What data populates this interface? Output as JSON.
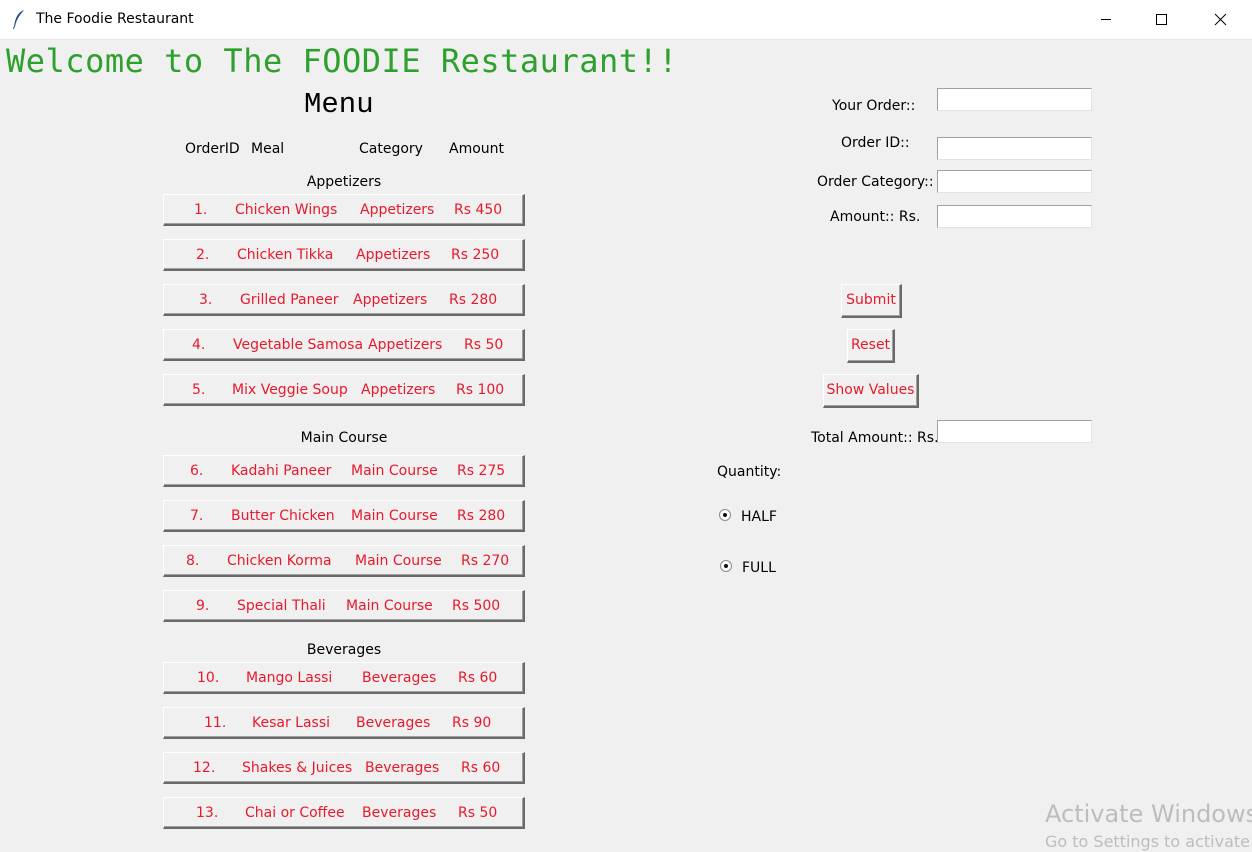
{
  "window": {
    "title": "The Foodie Restaurant",
    "minimize_icon": "minimize-icon",
    "maximize_icon": "maximize-icon",
    "close_icon": "close-icon"
  },
  "welcome": "Welcome to The FOODIE Restaurant!!",
  "menu": {
    "title": "Menu",
    "headers": [
      "OrderID",
      "Meal",
      "Category",
      "Amount"
    ],
    "sections": {
      "appetizers": "Appetizers",
      "main_course": "Main Course",
      "beverages": "Beverages"
    },
    "items": [
      {
        "id": "1.",
        "meal": "Chicken Wings",
        "category": "Appetizers",
        "amount": "Rs 450"
      },
      {
        "id": "2.",
        "meal": "Chicken Tikka",
        "category": "Appetizers",
        "amount": "Rs 250"
      },
      {
        "id": "3.",
        "meal": "Grilled Paneer",
        "category": "Appetizers",
        "amount": "Rs 280"
      },
      {
        "id": "4.",
        "meal": "Vegetable Samosa",
        "category": "Appetizers",
        "amount": "Rs 50"
      },
      {
        "id": "5.",
        "meal": "Mix Veggie Soup",
        "category": "Appetizers",
        "amount": "Rs 100"
      },
      {
        "id": "6.",
        "meal": "Kadahi Paneer",
        "category": "Main Course",
        "amount": "Rs 275"
      },
      {
        "id": "7.",
        "meal": "Butter Chicken",
        "category": "Main Course",
        "amount": "Rs 280"
      },
      {
        "id": "8.",
        "meal": "Chicken Korma",
        "category": "Main Course",
        "amount": "Rs 270"
      },
      {
        "id": "9.",
        "meal": "Special Thali",
        "category": "Main Course",
        "amount": "Rs 500"
      },
      {
        "id": "10.",
        "meal": "Mango Lassi",
        "category": "Beverages",
        "amount": "Rs 60"
      },
      {
        "id": "11.",
        "meal": "Kesar Lassi",
        "category": "Beverages",
        "amount": "Rs 90"
      },
      {
        "id": "12.",
        "meal": "Shakes & Juices",
        "category": "Beverages",
        "amount": "Rs 60"
      },
      {
        "id": "13.",
        "meal": "Chai or Coffee",
        "category": "Beverages",
        "amount": "Rs 50"
      }
    ]
  },
  "form": {
    "your_order_label": "Your Order::",
    "order_id_label": "Order ID::",
    "order_category_label": "Order Category::",
    "amount_label": "Amount:: Rs.",
    "your_order_value": "",
    "order_id_value": "",
    "order_category_value": "",
    "amount_value": "",
    "submit": "Submit",
    "reset": "Reset",
    "show_values": "Show Values",
    "total_label": "Total Amount:: Rs.",
    "total_value": "",
    "quantity_label": "Quantity:",
    "half": "HALF",
    "full": "FULL"
  },
  "watermark": {
    "line1": "Activate Windows",
    "line2": "Go to Settings to activate"
  },
  "colors": {
    "welcome": "#2ea02e",
    "button_text": "#e8192c"
  }
}
